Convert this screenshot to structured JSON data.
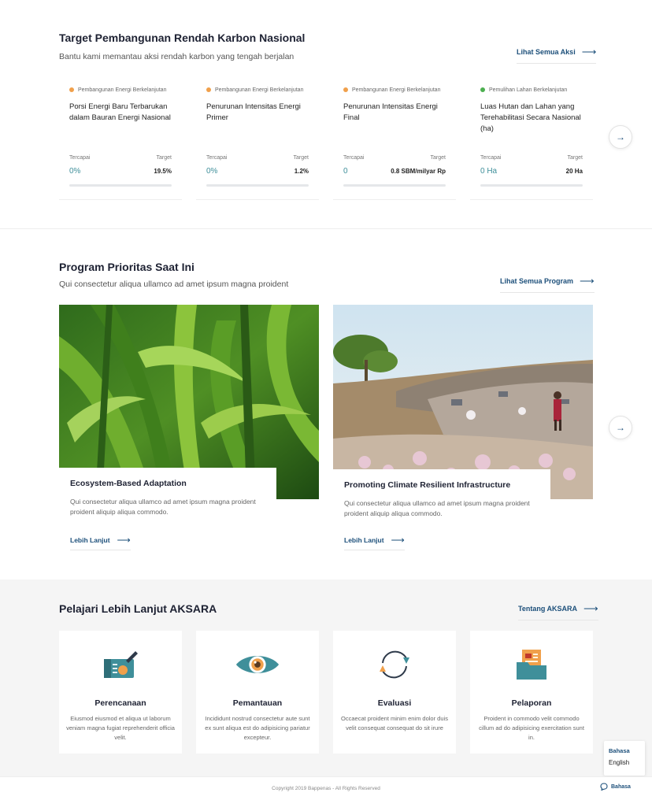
{
  "targets": {
    "title": "Target Pembangunan Rendah Karbon Nasional",
    "subtitle": "Bantu kami memantau aksi rendah karbon yang tengah berjalan",
    "see_all_label": "Lihat Semua Aksi",
    "achieved_label": "Tercapai",
    "target_label": "Target",
    "cards": [
      {
        "category": "Pembangunan Energi Berkelanjutan",
        "dot_color": "#f0a04b",
        "title": "Porsi Energi Baru Terbarukan dalam Bauran Energi Nasional",
        "achieved": "0%",
        "target": "19.5%",
        "progress": 0
      },
      {
        "category": "Pembangunan Energi Berkelanjutan",
        "dot_color": "#f0a04b",
        "title": "Penurunan Intensitas Energi Primer",
        "achieved": "0%",
        "target": "1.2%",
        "progress": 0
      },
      {
        "category": "Pembangunan Energi Berkelanjutan",
        "dot_color": "#f0a04b",
        "title": "Penurunan Intensitas Energi Final",
        "achieved": "0",
        "target": "0.8 SBM/milyar Rp",
        "progress": 0
      },
      {
        "category": "Pemulihan Lahan Berkelanjutan",
        "dot_color": "#4caf50",
        "title": "Luas Hutan dan Lahan yang Terehabilitasi Secara Nasional (ha)",
        "achieved": "0 Ha",
        "target": "20 Ha",
        "progress": 0
      }
    ]
  },
  "programs": {
    "title": "Program Prioritas Saat Ini",
    "subtitle": "Qui consectetur aliqua ullamco ad amet ipsum magna proident",
    "see_all_label": "Lihat Semua Program",
    "cards": [
      {
        "title": "Ecosystem-Based Adaptation",
        "description": "Qui consectetur aliqua ullamco ad amet ipsum magna proident proident aliquip aliqua commodo.",
        "more_label": "Lebih Lanjut"
      },
      {
        "title": "Promoting Climate Resilient Infrastructure",
        "description": "Qui consectetur aliqua ullamco ad amet ipsum magna proident proident aliquip aliqua commodo.",
        "more_label": "Lebih Lanjut"
      }
    ]
  },
  "aksara": {
    "title": "Pelajari Lebih Lanjut AKSARA",
    "about_label": "Tentang AKSARA",
    "cards": [
      {
        "icon": "planning-icon",
        "title": "Perencanaan",
        "description": "Eiusmod eiusmod et aliqua ut laborum veniam magna fugiat reprehenderit officia velit."
      },
      {
        "icon": "eye-icon",
        "title": "Pemantauan",
        "description": "Incididunt nostrud consectetur aute sunt ex sunt aliqua est do adipisicing pariatur excepteur."
      },
      {
        "icon": "refresh-icon",
        "title": "Evaluasi",
        "description": "Occaecat proident minim enim dolor duis velit consequat consequat do sit irure"
      },
      {
        "icon": "report-folder-icon",
        "title": "Pelaporan",
        "description": "Proident in commodo velit commodo cillum ad do adipisicing exercitation sunt in."
      }
    ]
  },
  "footer": {
    "copyright": "Copyright 2019 Bappenas - All Rights Reserved",
    "language_button": "Bahasa",
    "language_menu": {
      "current": "Bahasa",
      "option": "English"
    }
  },
  "colors": {
    "accent": "#1c4f7a",
    "teal": "#3f8f9a",
    "orange": "#f0a04b",
    "green": "#4caf50"
  }
}
